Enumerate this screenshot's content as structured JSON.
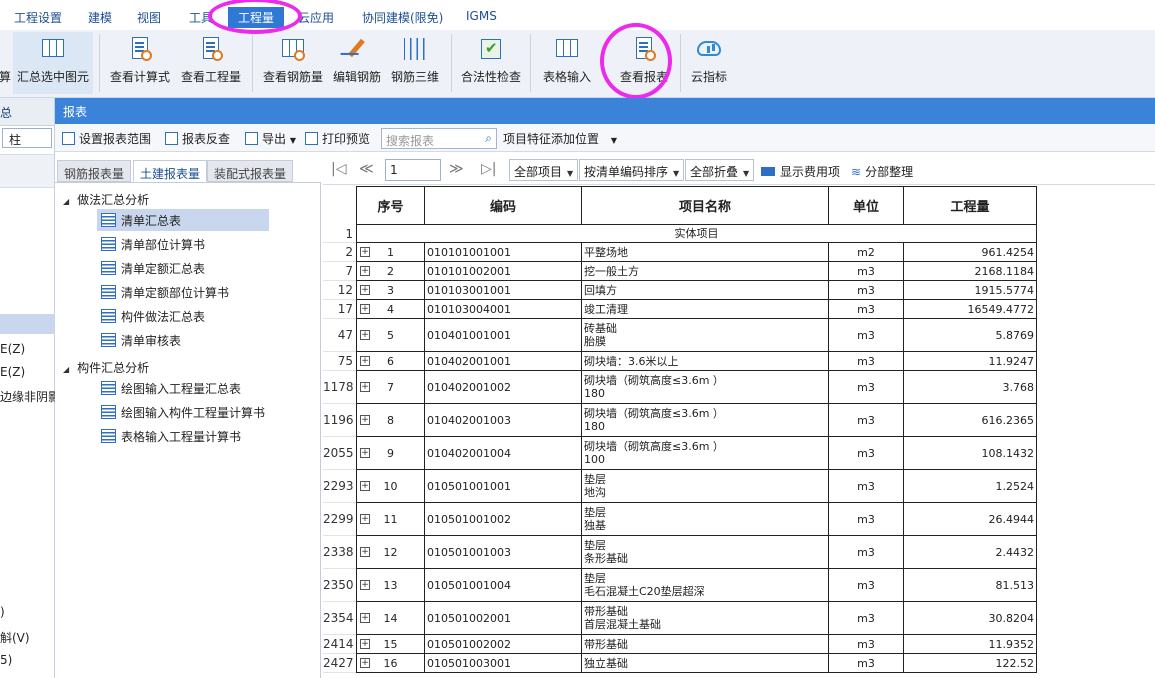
{
  "menu": {
    "tabs": [
      "工程设置",
      "建模",
      "视图",
      "工具",
      "工程量",
      "云应用",
      "协同建模(限免)",
      "IGMS"
    ],
    "active_index": 4
  },
  "ribbon": {
    "buttons": [
      {
        "label": "算",
        "icon": "partial-icon"
      },
      {
        "label": "汇总选中图元",
        "icon": "summary-selected-icon"
      },
      {
        "label": "查看计算式",
        "icon": "view-formula-icon"
      },
      {
        "label": "查看工程量",
        "icon": "view-quantity-icon"
      },
      {
        "label": "查看钢筋量",
        "icon": "view-rebar-icon"
      },
      {
        "label": "编辑钢筋",
        "icon": "edit-rebar-icon"
      },
      {
        "label": "钢筋三维",
        "icon": "rebar-3d-icon"
      },
      {
        "label": "合法性检查",
        "icon": "validity-check-icon"
      },
      {
        "label": "表格输入",
        "icon": "table-input-icon"
      },
      {
        "label": "查看报表",
        "icon": "view-report-icon"
      },
      {
        "label": "云指标",
        "icon": "cloud-index-icon"
      }
    ]
  },
  "left_pane": {
    "header": "汇总",
    "input_value": "柱",
    "items": [
      "E(Z)",
      "E(Z)",
      "边缘非阴影[",
      ")",
      "斛(V)",
      "5)"
    ]
  },
  "report": {
    "title": "报表",
    "toolbar": {
      "set_range": "设置报表范围",
      "reverse_check": "报表反查",
      "export": "导出",
      "print_preview": "打印预览",
      "search_placeholder": "搜索报表",
      "feature_position": "项目特征添加位置"
    },
    "tabs": [
      "钢筋报表量",
      "土建报表量",
      "装配式报表量"
    ],
    "active_tab": 1,
    "tree": {
      "group1": "做法汇总分析",
      "group1_items": [
        "清单汇总表",
        "清单部位计算书",
        "清单定额汇总表",
        "清单定额部位计算书",
        "构件做法汇总表",
        "清单审核表"
      ],
      "group2": "构件汇总分析",
      "group2_items": [
        "绘图输入工程量汇总表",
        "绘图输入构件工程量计算书",
        "表格输入工程量计算书"
      ]
    },
    "nav": {
      "page": "1",
      "all_items": "全部项目",
      "sort": "按清单编码排序",
      "fold": "全部折叠",
      "show_cost": "显示费用项",
      "arrange": "分部整理"
    },
    "table": {
      "headers": [
        "序号",
        "编码",
        "项目名称",
        "单位",
        "工程量"
      ],
      "section_row_num": "1",
      "section_label": "实体项目",
      "rows": [
        {
          "rn": "2",
          "seq": "1",
          "code": "010101001001",
          "name": [
            "平整场地"
          ],
          "unit": "m2",
          "qty": "961.4254"
        },
        {
          "rn": "7",
          "seq": "2",
          "code": "010101002001",
          "name": [
            "挖一般土方"
          ],
          "unit": "m3",
          "qty": "2168.1184"
        },
        {
          "rn": "12",
          "seq": "3",
          "code": "010103001001",
          "name": [
            "回填方"
          ],
          "unit": "m3",
          "qty": "1915.5774"
        },
        {
          "rn": "17",
          "seq": "4",
          "code": "010103004001",
          "name": [
            "竣工清理"
          ],
          "unit": "m3",
          "qty": "16549.4772"
        },
        {
          "rn": "47",
          "seq": "5",
          "code": "010401001001",
          "name": [
            "砖基础",
            "胎膜"
          ],
          "unit": "m3",
          "qty": "5.8769"
        },
        {
          "rn": "75",
          "seq": "6",
          "code": "010402001001",
          "name": [
            "砌块墙：3.6米以上"
          ],
          "unit": "m3",
          "qty": "11.9247"
        },
        {
          "rn": "1178",
          "seq": "7",
          "code": "010402001002",
          "name": [
            "砌块墙（砌筑高度≤3.6m ）",
            "180"
          ],
          "unit": "m3",
          "qty": "3.768"
        },
        {
          "rn": "1196",
          "seq": "8",
          "code": "010402001003",
          "name": [
            "砌块墙（砌筑高度≤3.6m ）",
            "180"
          ],
          "unit": "m3",
          "qty": "616.2365"
        },
        {
          "rn": "2055",
          "seq": "9",
          "code": "010402001004",
          "name": [
            "砌块墙（砌筑高度≤3.6m ）",
            "100"
          ],
          "unit": "m3",
          "qty": "108.1432"
        },
        {
          "rn": "2293",
          "seq": "10",
          "code": "010501001001",
          "name": [
            "垫层",
            "地沟"
          ],
          "unit": "m3",
          "qty": "1.2524"
        },
        {
          "rn": "2299",
          "seq": "11",
          "code": "010501001002",
          "name": [
            "垫层",
            "独基"
          ],
          "unit": "m3",
          "qty": "26.4944"
        },
        {
          "rn": "2338",
          "seq": "12",
          "code": "010501001003",
          "name": [
            "垫层",
            "条形基础"
          ],
          "unit": "m3",
          "qty": "2.4432"
        },
        {
          "rn": "2350",
          "seq": "13",
          "code": "010501001004",
          "name": [
            "垫层",
            "毛石混凝土C20垫层超深"
          ],
          "unit": "m3",
          "qty": "81.513"
        },
        {
          "rn": "2354",
          "seq": "14",
          "code": "010501002001",
          "name": [
            "带形基础",
            "首层混凝土基础"
          ],
          "unit": "m3",
          "qty": "30.8204"
        },
        {
          "rn": "2414",
          "seq": "15",
          "code": "010501002002",
          "name": [
            "带形基础"
          ],
          "unit": "m3",
          "qty": "11.9352"
        },
        {
          "rn": "2427",
          "seq": "16",
          "code": "010501003001",
          "name": [
            "独立基础"
          ],
          "unit": "m3",
          "qty": "122.52"
        }
      ]
    }
  },
  "colors": {
    "accent": "#2f78d4",
    "panel_title": "#3b82d9",
    "highlight": "#ec2aeb",
    "selection": "#c8d7ee"
  }
}
